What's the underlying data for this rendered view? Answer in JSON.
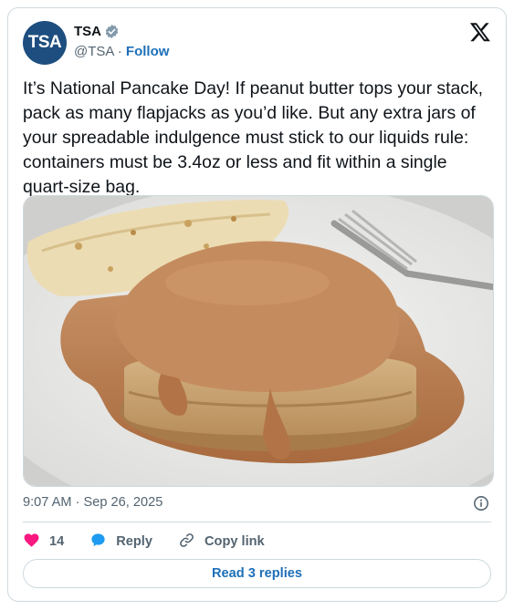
{
  "account": {
    "avatar_text": "TSA",
    "display_name": "TSA",
    "handle": "@TSA",
    "separator": "·",
    "follow_label": "Follow"
  },
  "tweet": {
    "text": "It’s National Pancake Day! If peanut butter tops your stack, pack as many flapjacks as you’d like. But any extra jars of your spreadable indulgence must stick to our liquids rule: containers must be 3.4oz or less and fit within a single quart-size bag.",
    "timestamp": "9:07 AM · Sep 26, 2025"
  },
  "actions": {
    "like_count": "14",
    "reply_label": "Reply",
    "copy_link_label": "Copy link"
  },
  "read_replies_label": "Read 3 replies",
  "colors": {
    "link": "#1d6fb8",
    "avatar_bg": "#1d4e7f",
    "like": "#f91880",
    "border": "#cfd9de",
    "secondary_text": "#536471"
  },
  "icons": [
    "verified-badge-icon",
    "x-logo-icon",
    "info-icon",
    "heart-icon",
    "reply-bubble-icon",
    "link-icon"
  ]
}
